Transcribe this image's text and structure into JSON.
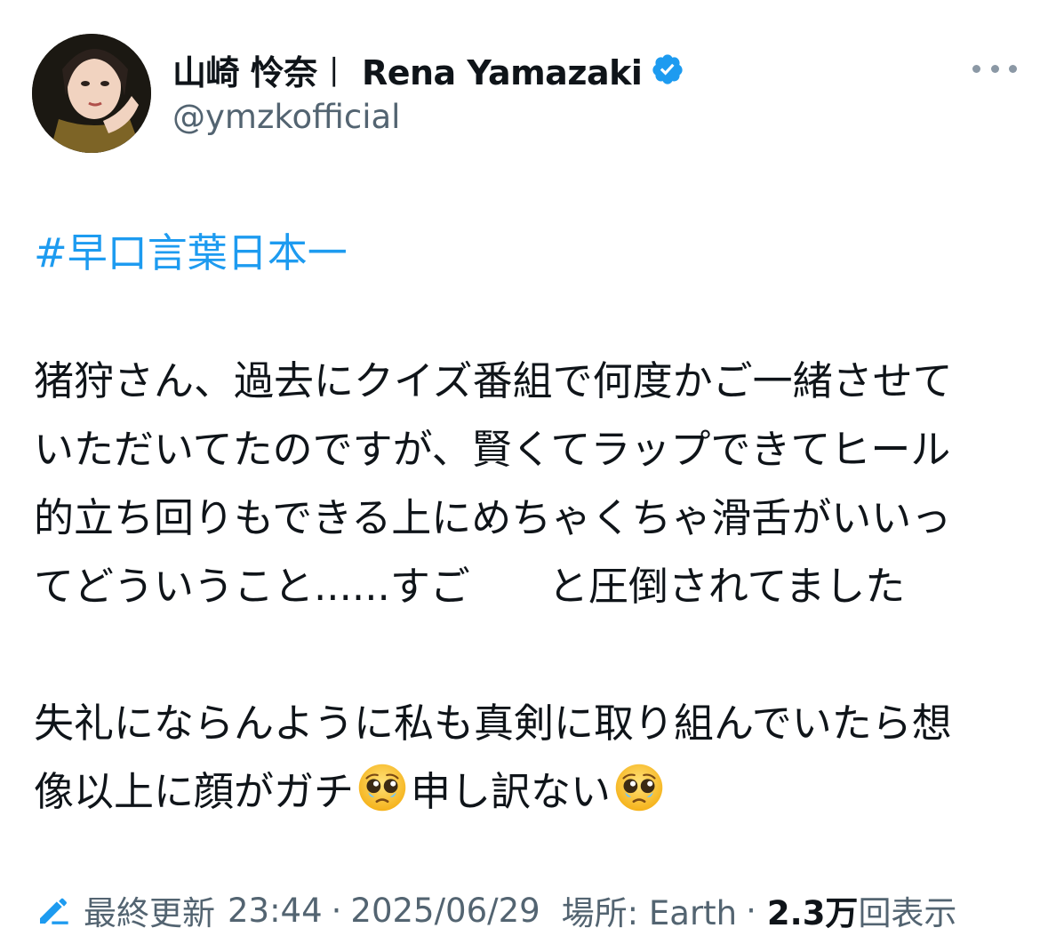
{
  "post": {
    "display_name": "山崎 怜奈︱ Rena Yamazaki",
    "handle": "@ymzkofficial",
    "hashtag": "#早口言葉日本一",
    "paragraph1": {
      "line1": "猪狩さん、過去にクイズ番組で何度かご一緒させて",
      "line2": "いただいてたのですが、賢くてラップできてヒール",
      "line3": "的立ち回りもできる上にめちゃくちゃ滑舌がいいっ",
      "line4a": "てどういうこと......すご",
      "line4b": "と圧倒されてました"
    },
    "paragraph2": {
      "line1": "失礼にならんように私も真剣に取り組んでいたら想",
      "line2a": "像以上に顔がガチ",
      "line2b": "申し訳ない"
    }
  },
  "footer": {
    "edited_label": "最終更新",
    "time": "23:44",
    "separator": "·",
    "date": "2025/06/29",
    "location": "場所: Earth",
    "views_count": "2.3万",
    "views_label": "回表示"
  },
  "icons": {
    "verified": "verified-badge-icon",
    "more": "more-icon",
    "edit": "edit-pencil-icon",
    "emoji": "pleading-face-icon"
  },
  "colors": {
    "link": "#1d9bf0",
    "secondary_text": "#536471",
    "verified": "#1d9bf0"
  }
}
